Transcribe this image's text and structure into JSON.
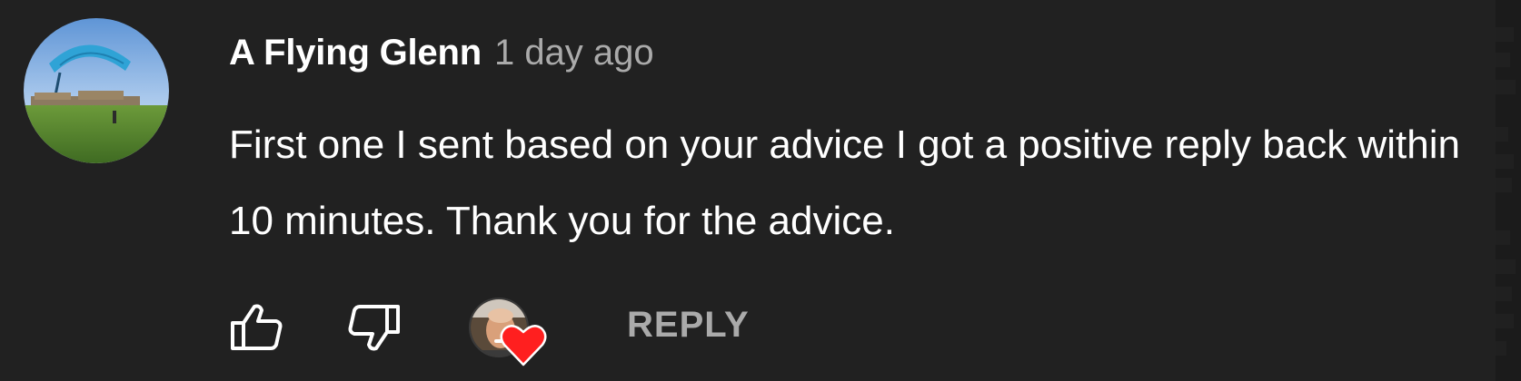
{
  "comment": {
    "author": "A Flying Glenn",
    "timestamp": "1 day ago",
    "text": "First one I sent based on your advice I got a positive reply back within 10 minutes. Thank you for the advice."
  },
  "actions": {
    "like_icon": "thumb-up-outline",
    "dislike_icon": "thumb-down-outline",
    "creator_heart_icon": "heart",
    "reply_label": "REPLY"
  },
  "colors": {
    "background": "#212121",
    "primary_text": "#ffffff",
    "secondary_text": "#aaaaaa",
    "heart": "#ff1f1f"
  }
}
